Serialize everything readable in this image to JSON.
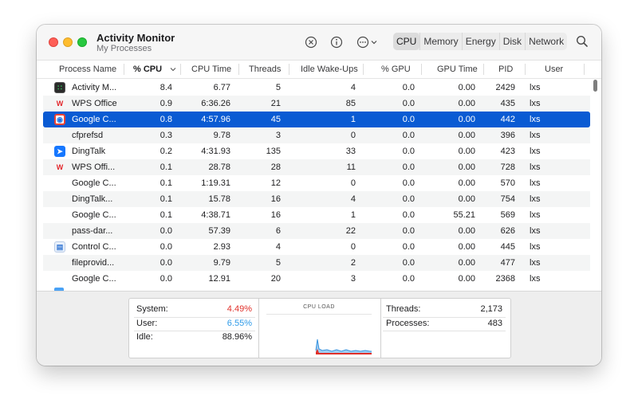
{
  "window": {
    "title": "Activity Monitor",
    "subtitle": "My Processes"
  },
  "toolbar": {
    "icons": [
      "stop-process-icon",
      "info-icon",
      "more-actions-icon",
      "search-icon"
    ],
    "tabs": [
      {
        "label": "CPU",
        "active": true
      },
      {
        "label": "Memory",
        "active": false
      },
      {
        "label": "Energy",
        "active": false
      },
      {
        "label": "Disk",
        "active": false
      },
      {
        "label": "Network",
        "active": false
      }
    ]
  },
  "table": {
    "columns": [
      "Process Name",
      "% CPU",
      "CPU Time",
      "Threads",
      "Idle Wake-Ups",
      "% GPU",
      "GPU Time",
      "PID",
      "User"
    ],
    "sorted_column": "% CPU",
    "rows": [
      {
        "icon": "activity-monitor-icon",
        "name": "Activity M...",
        "cpu": "8.4",
        "cpu_time": "6.77",
        "threads": "5",
        "idle_wakeups": "4",
        "gpu": "0.0",
        "gpu_time": "0.00",
        "pid": "2429",
        "user": "lxs"
      },
      {
        "icon": "wps-icon",
        "name": "WPS Office",
        "cpu": "0.9",
        "cpu_time": "6:36.26",
        "threads": "21",
        "idle_wakeups": "85",
        "gpu": "0.0",
        "gpu_time": "0.00",
        "pid": "435",
        "user": "lxs"
      },
      {
        "icon": "chrome-icon",
        "name": "Google C...",
        "cpu": "0.8",
        "cpu_time": "4:57.96",
        "threads": "45",
        "idle_wakeups": "1",
        "gpu": "0.0",
        "gpu_time": "0.00",
        "pid": "442",
        "user": "lxs",
        "selected": true
      },
      {
        "icon": "",
        "name": "cfprefsd",
        "cpu": "0.3",
        "cpu_time": "9.78",
        "threads": "3",
        "idle_wakeups": "0",
        "gpu": "0.0",
        "gpu_time": "0.00",
        "pid": "396",
        "user": "lxs"
      },
      {
        "icon": "dingtalk-icon",
        "name": "DingTalk",
        "cpu": "0.2",
        "cpu_time": "4:31.93",
        "threads": "135",
        "idle_wakeups": "33",
        "gpu": "0.0",
        "gpu_time": "0.00",
        "pid": "423",
        "user": "lxs"
      },
      {
        "icon": "wps-icon",
        "name": "WPS Offi...",
        "cpu": "0.1",
        "cpu_time": "28.78",
        "threads": "28",
        "idle_wakeups": "11",
        "gpu": "0.0",
        "gpu_time": "0.00",
        "pid": "728",
        "user": "lxs"
      },
      {
        "icon": "",
        "name": "Google C...",
        "cpu": "0.1",
        "cpu_time": "1:19.31",
        "threads": "12",
        "idle_wakeups": "0",
        "gpu": "0.0",
        "gpu_time": "0.00",
        "pid": "570",
        "user": "lxs"
      },
      {
        "icon": "",
        "name": "DingTalk...",
        "cpu": "0.1",
        "cpu_time": "15.78",
        "threads": "16",
        "idle_wakeups": "4",
        "gpu": "0.0",
        "gpu_time": "0.00",
        "pid": "754",
        "user": "lxs"
      },
      {
        "icon": "",
        "name": "Google C...",
        "cpu": "0.1",
        "cpu_time": "4:38.71",
        "threads": "16",
        "idle_wakeups": "1",
        "gpu": "0.0",
        "gpu_time": "55.21",
        "pid": "569",
        "user": "lxs"
      },
      {
        "icon": "",
        "name": "pass-dar...",
        "cpu": "0.0",
        "cpu_time": "57.39",
        "threads": "6",
        "idle_wakeups": "22",
        "gpu": "0.0",
        "gpu_time": "0.00",
        "pid": "626",
        "user": "lxs"
      },
      {
        "icon": "control-center-icon",
        "name": "Control C...",
        "cpu": "0.0",
        "cpu_time": "2.93",
        "threads": "4",
        "idle_wakeups": "0",
        "gpu": "0.0",
        "gpu_time": "0.00",
        "pid": "445",
        "user": "lxs"
      },
      {
        "icon": "",
        "name": "fileprovid...",
        "cpu": "0.0",
        "cpu_time": "9.79",
        "threads": "5",
        "idle_wakeups": "2",
        "gpu": "0.0",
        "gpu_time": "0.00",
        "pid": "477",
        "user": "lxs"
      },
      {
        "icon": "",
        "name": "Google C...",
        "cpu": "0.0",
        "cpu_time": "12.91",
        "threads": "20",
        "idle_wakeups": "3",
        "gpu": "0.0",
        "gpu_time": "0.00",
        "pid": "2368",
        "user": "lxs"
      }
    ]
  },
  "summary": {
    "system_label": "System:",
    "system_value": "4.49%",
    "user_label": "User:",
    "user_value": "6.55%",
    "idle_label": "Idle:",
    "idle_value": "88.96%",
    "cpu_load_title": "CPU LOAD",
    "threads_label": "Threads:",
    "threads_value": "2,173",
    "processes_label": "Processes:",
    "processes_value": "483"
  },
  "colors": {
    "selection": "#0a5bd3",
    "system": "#e0302a",
    "user": "#2f9be8",
    "close": "#fe5f57",
    "minimize": "#febc2e",
    "zoom": "#28c840"
  }
}
